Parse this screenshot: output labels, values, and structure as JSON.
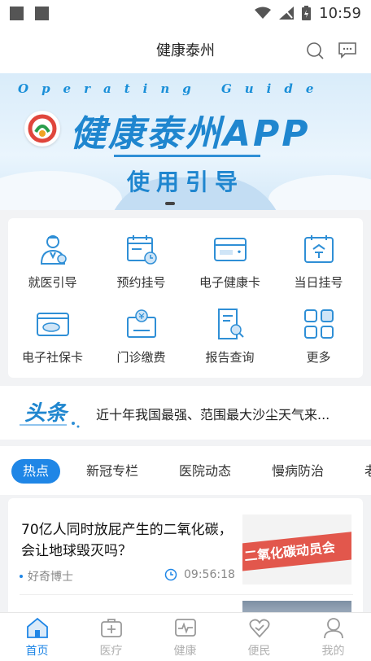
{
  "status_bar": {
    "time": "10:59"
  },
  "header": {
    "title": "健康泰州",
    "search_icon": "search-icon",
    "message_icon": "message-icon"
  },
  "banner": {
    "guide_text": "Operating Guide",
    "title": "健康泰州APP",
    "subtitle": "使用引导"
  },
  "services": [
    {
      "label": "就医引导",
      "icon": "doctor-icon"
    },
    {
      "label": "预约挂号",
      "icon": "calendar-clock-icon"
    },
    {
      "label": "电子健康卡",
      "icon": "health-card-icon"
    },
    {
      "label": "当日挂号",
      "icon": "today-calendar-icon"
    },
    {
      "label": "电子社保卡",
      "icon": "social-card-icon"
    },
    {
      "label": "门诊缴费",
      "icon": "payment-icon"
    },
    {
      "label": "报告查询",
      "icon": "report-search-icon"
    },
    {
      "label": "更多",
      "icon": "grid-more-icon"
    }
  ],
  "headline": {
    "logo_text": "头条",
    "text": "近十年我国最强、范围最大沙尘天气来..."
  },
  "tabs": [
    "热点",
    "新冠专栏",
    "医院动态",
    "慢病防治",
    "老"
  ],
  "news": [
    {
      "title": "70亿人同时放屁产生的二氧化碳，会让地球毁灭吗？",
      "source": "好奇博士",
      "time": "09:56:18",
      "thumb_text": "二氧化碳动员会"
    }
  ],
  "bottom_nav": [
    {
      "label": "首页",
      "icon": "home-icon",
      "active": true
    },
    {
      "label": "医疗",
      "icon": "medical-kit-icon",
      "active": false
    },
    {
      "label": "健康",
      "icon": "heartbeat-icon",
      "active": false
    },
    {
      "label": "便民",
      "icon": "heart-hand-icon",
      "active": false
    },
    {
      "label": "我的",
      "icon": "user-icon",
      "active": false
    }
  ],
  "colors": {
    "accent": "#1f86e6",
    "banner_blue": "#1f86cf",
    "icon_blue": "#2f8fd6"
  }
}
